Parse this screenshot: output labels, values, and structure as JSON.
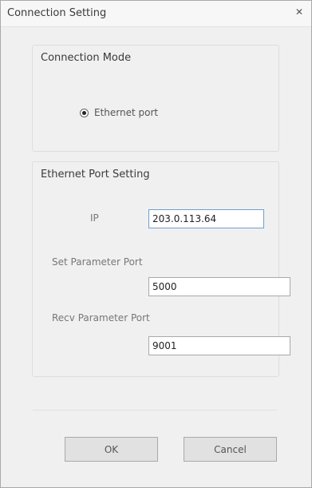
{
  "window": {
    "title": "Connection Setting",
    "close_glyph": "✕"
  },
  "connection_mode": {
    "title": "Connection Mode",
    "option_label": "Ethernet port",
    "selected": true
  },
  "ethernet": {
    "title": "Ethernet Port Setting",
    "ip_label": "IP",
    "ip_value": "203.0.113.64",
    "set_port_label": "Set Parameter Port",
    "set_port_value": "5000",
    "recv_port_label": "Recv Parameter Port",
    "recv_port_value": "9001"
  },
  "buttons": {
    "ok": "OK",
    "cancel": "Cancel"
  },
  "icons": {
    "close": "close-icon"
  },
  "colors": {
    "focus_border": "#6fa0cf",
    "button_bg": "#e1e1e1",
    "window_bg": "#f0f0f0"
  }
}
